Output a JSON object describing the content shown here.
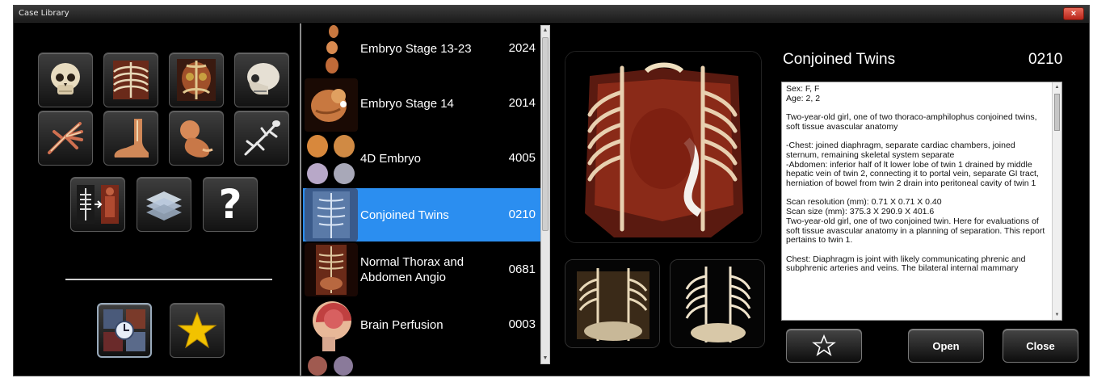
{
  "window": {
    "title": "Case Library",
    "close_glyph": "×"
  },
  "left_panel": {
    "icons": [
      "skull-icon",
      "chest-icon",
      "abdomen-icon",
      "skull-side-icon",
      "hand-icon",
      "foot-icon",
      "fetus-icon",
      "lizard-icon",
      "compare-icon",
      "layers-icon",
      "help-icon",
      "recent-icon",
      "favorites-star-icon"
    ],
    "help_glyph": "?"
  },
  "case_list": {
    "items": [
      {
        "name": "Embryo Stage 13-23",
        "id": "2024",
        "selected": false
      },
      {
        "name": "Embryo Stage 14",
        "id": "2014",
        "selected": false
      },
      {
        "name": "4D Embryo",
        "id": "4005",
        "selected": false
      },
      {
        "name": "Conjoined Twins",
        "id": "0210",
        "selected": true
      },
      {
        "name": "Normal Thorax and Abdomen Angio",
        "id": "0681",
        "selected": false
      },
      {
        "name": "Brain Perfusion",
        "id": "0003",
        "selected": false
      }
    ]
  },
  "details": {
    "title": "Conjoined Twins",
    "id": "0210",
    "description": "Sex: F, F\nAge: 2, 2\n\nTwo-year-old girl, one of two thoraco-amphilophus conjoined twins, soft tissue avascular anatomy\n\n-Chest: joined diaphragm, separate cardiac chambers, joined sternum, remaining skeletal system separate\n-Abdomen: inferior half of lt lower lobe of twin 1 drained by middle hepatic vein of twin 2, connecting it to portal vein, separate GI tract, herniation of bowel from twin 2 drain into peritoneal cavity of twin 1\n\nScan resolution (mm): 0.71 X 0.71 X 0.40\nScan size (mm): 375.3 X 290.9 X 401.6\nTwo-year-old girl, one of two conjoined twin. Here for evaluations of soft tissue avascular anatomy in a planning of separation. This report pertains to twin 1.\n\nChest: Diaphragm is joint with likely communicating phrenic and subphrenic arteries and veins. The bilateral internal mammary",
    "buttons": {
      "open": "Open",
      "close": "Close"
    }
  },
  "colors": {
    "selected_row": "#2b8ef0",
    "background": "#000000",
    "star": "#f2c200"
  }
}
